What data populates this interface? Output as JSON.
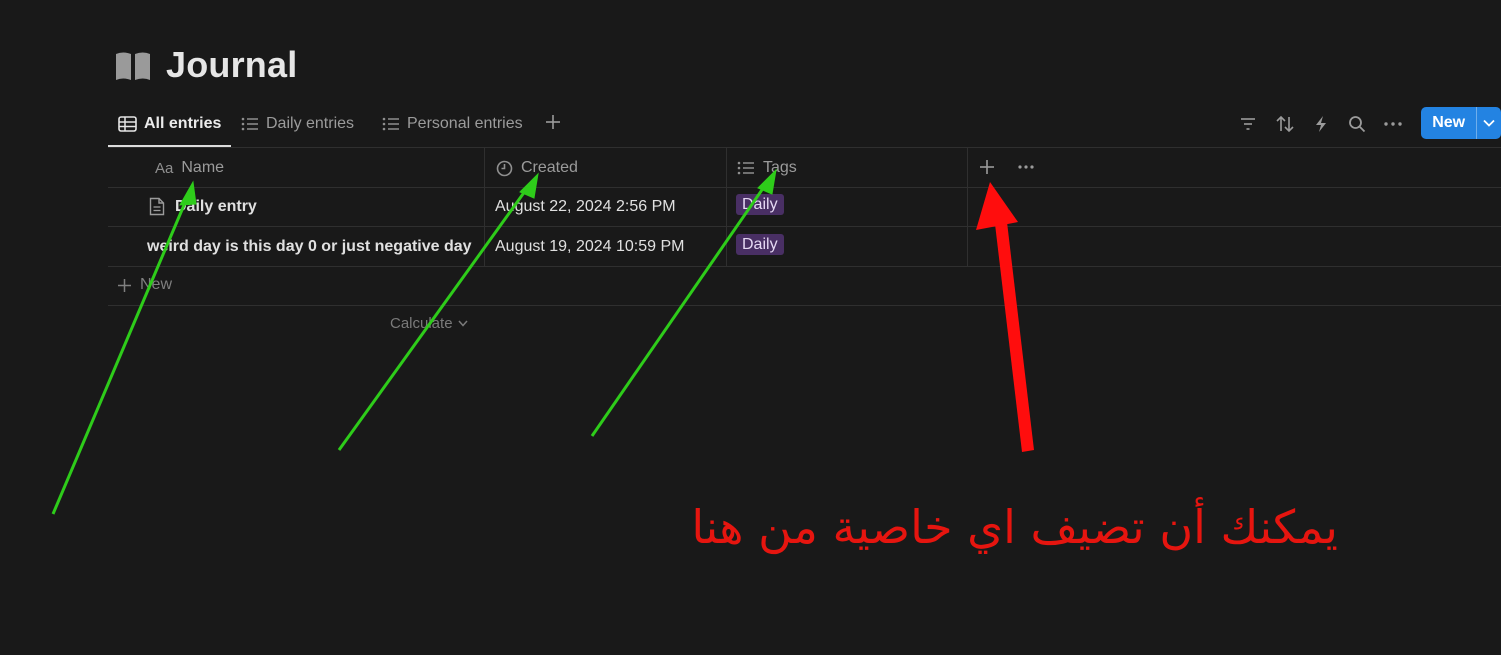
{
  "page": {
    "title": "Journal",
    "icon": "book-icon"
  },
  "tabs": [
    {
      "label": "All entries",
      "icon": "table-icon",
      "active": true
    },
    {
      "label": "Daily entries",
      "icon": "list-icon",
      "active": false
    },
    {
      "label": "Personal entries",
      "icon": "list-icon",
      "active": false
    }
  ],
  "toolbar": {
    "icons": [
      "filter-icon",
      "sort-icon",
      "automation-icon",
      "search-icon",
      "more-icon"
    ],
    "new_label": "New",
    "accent": "#2383e2"
  },
  "table": {
    "columns": [
      {
        "label": "Name",
        "icon_text": "Aa"
      },
      {
        "label": "Created",
        "icon": "clock-icon"
      },
      {
        "label": "Tags",
        "icon": "list-icon"
      }
    ],
    "rows": [
      {
        "name": "Daily entry",
        "created": "August 22, 2024 2:56 PM",
        "tag": "Daily"
      },
      {
        "name": "weird day is this day 0 or just negative day",
        "created": "August 19, 2024 10:59 PM",
        "tag": "Daily"
      }
    ],
    "new_row_label": "New",
    "calculate_label": "Calculate",
    "tag_color": "#492f64"
  },
  "annotation": {
    "text": "يمكنك أن تضيف اي خاصية من هنا",
    "text_color": "#e6150f",
    "green_arrow_color": "#2ecc1a",
    "red_arrow_color": "#ff0d0d"
  }
}
